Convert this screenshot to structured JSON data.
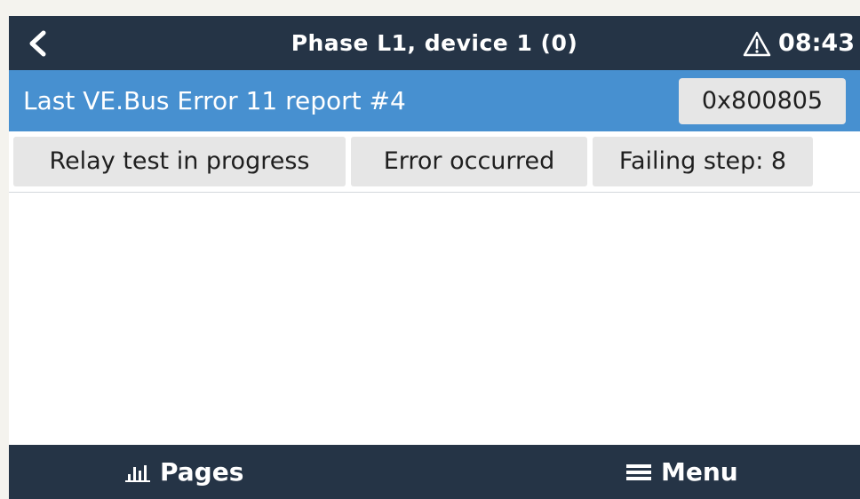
{
  "header": {
    "title": "Phase L1, device 1 (0)",
    "time": "08:43",
    "back_icon": "chevron-left-icon",
    "alert_icon": "warning-triangle-icon"
  },
  "info": {
    "label": "Last VE.Bus Error 11 report #4",
    "value": "0x800805"
  },
  "chips": [
    {
      "label": "Relay test in progress"
    },
    {
      "label": "Error occurred"
    },
    {
      "label": "Failing step: 8"
    }
  ],
  "footer": {
    "pages_label": "Pages",
    "pages_icon": "bar-chart-icon",
    "menu_label": "Menu",
    "menu_icon": "hamburger-icon"
  },
  "colors": {
    "header_bg": "#253446",
    "info_bg": "#4790d0",
    "chip_bg": "#e6e6e6",
    "page_bg": "#ffffff"
  }
}
